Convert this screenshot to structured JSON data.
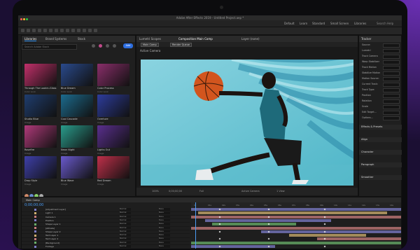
{
  "window": {
    "title": "Adobe After Effects 2019 - Untitled Project.aep *"
  },
  "menubar": {
    "items": [
      "Default",
      "Learn",
      "Standard",
      "Small Screen",
      "Libraries"
    ],
    "search_placeholder": "Search Help"
  },
  "left_panel": {
    "tabs": [
      "Libraries",
      "Brand Systems",
      "Stock"
    ],
    "search_placeholder": "Search Adobe Stock",
    "add_label": "Add",
    "thumbnails": [
      {
        "title": "Through The Lookin-Glass",
        "sub": "Color Look",
        "color": "#c2306a"
      },
      {
        "title": "Blue Dream",
        "sub": "Color Look",
        "color": "#2a4a8c"
      },
      {
        "title": "Color Process",
        "sub": "Color Look",
        "color": "#8a2e6a"
      },
      {
        "title": "Studio Blue",
        "sub": "Image",
        "color": "#1f3d6e"
      },
      {
        "title": "Cool Cascade",
        "sub": "Image",
        "color": "#1c6b8e"
      },
      {
        "title": "Overture",
        "sub": "Image",
        "color": "#2d3c9c"
      },
      {
        "title": "Rosefire",
        "sub": "Image",
        "color": "#b03a7a"
      },
      {
        "title": "Neon Night",
        "sub": "Image",
        "color": "#2a9c8c"
      },
      {
        "title": "Lights Out",
        "sub": "Image",
        "color": "#5a2f8e"
      },
      {
        "title": "Drop Style",
        "sub": "Image",
        "color": "#3e3fa8"
      },
      {
        "title": "Blue Wave",
        "sub": "Image",
        "color": "#6a5acd"
      },
      {
        "title": "Red Dream",
        "sub": "Image",
        "color": "#c0304a"
      }
    ]
  },
  "viewer": {
    "tabs": [
      "Lumetri Scopes",
      "Composition Main Comp",
      "Layer (none)"
    ],
    "subtabs": [
      "Main Comp",
      "Render Queue"
    ],
    "active_camera": "Active Camera",
    "footer": {
      "zoom": "100%",
      "time": "0;00;00;00",
      "quality": "Full",
      "camera": "Active Camera",
      "view": "1 View"
    }
  },
  "right_panel": {
    "title": "Tracker",
    "rows": [
      "Source:",
      "Lumetri",
      "Track Camera",
      "Warp Stabilizer",
      "Track Motion",
      "Stabilize Motion",
      "Motion Source:",
      "Current Track:",
      "Track Type:",
      "Position",
      "Rotation",
      "Scale",
      "Edit Target...",
      "Options..."
    ],
    "sections": [
      "Effects & Presets",
      "Align",
      "Character",
      "Paragraph",
      "Smoother"
    ]
  },
  "timeline": {
    "tab": "Main Comp",
    "time": "0;00;00;00",
    "ruler": [
      "0s",
      "01s",
      "02s",
      "03s",
      "04s",
      "05s",
      "06s",
      "07s",
      "08s",
      "09s",
      "10s",
      "11s",
      "12s",
      "13s",
      "14s"
    ],
    "layers": [
      {
        "name": "[Adjustment Layer]",
        "mode": "Normal",
        "trk": "None",
        "color": "#7c7cc8"
      },
      {
        "name": "Light 1",
        "mode": "Normal",
        "trk": "None",
        "color": "#d0b070"
      },
      {
        "name": "Camera 1",
        "mode": "Normal",
        "trk": "None",
        "color": "#c87c7c"
      },
      {
        "name": "Position",
        "mode": "Normal",
        "trk": "None",
        "color": "#7c7cc8"
      },
      {
        "name": "Shape Layer 1",
        "mode": "Normal",
        "trk": "None",
        "color": "#6ab06a"
      },
      {
        "name": "[Athlete]",
        "mode": "Normal",
        "trk": "None",
        "color": "#c87c7c"
      },
      {
        "name": "Shape Layer 2",
        "mode": "Normal",
        "trk": "None",
        "color": "#7c7cc8"
      },
      {
        "name": "Text Layer 1",
        "mode": "Normal",
        "trk": "None",
        "color": "#d0b070"
      },
      {
        "name": "Text Layer 2",
        "mode": "Normal",
        "trk": "None",
        "color": "#c87c7c"
      },
      {
        "name": "[Background]",
        "mode": "Normal",
        "trk": "None",
        "color": "#6ab06a"
      },
      {
        "name": "Footage",
        "mode": "Normal",
        "trk": "None",
        "color": "#7c7cc8"
      }
    ]
  }
}
